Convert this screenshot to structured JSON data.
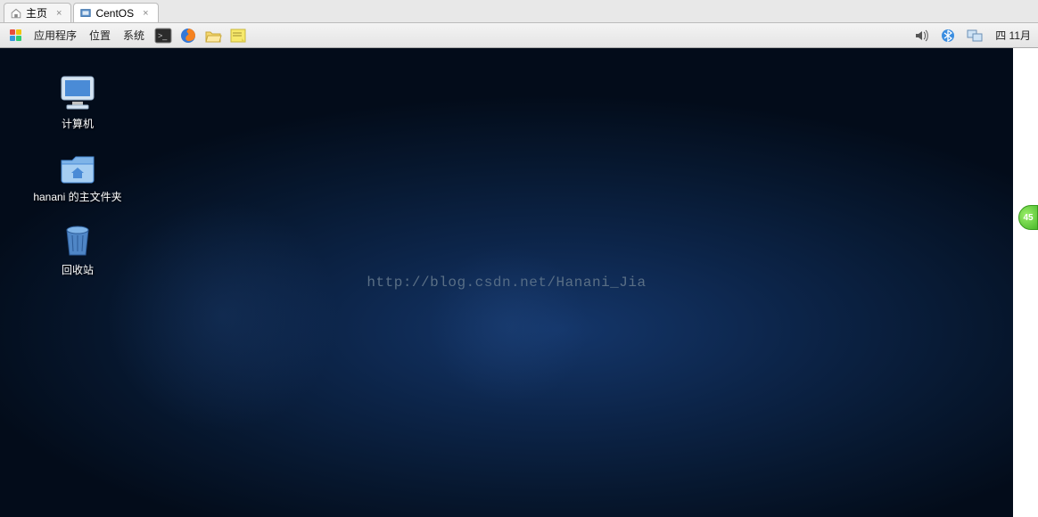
{
  "vm_tabs": [
    {
      "label": "主页",
      "active": false
    },
    {
      "label": "CentOS",
      "active": true
    }
  ],
  "gnome_menu": {
    "apps": "应用程序",
    "places": "位置",
    "system": "系统"
  },
  "panel_date": "四 11月",
  "desktop_icons": {
    "computer": "计算机",
    "home": "hanani 的主文件夹",
    "trash": "回收站"
  },
  "watermark": "http://blog.csdn.net/Hanani_Jia",
  "badge": "45"
}
